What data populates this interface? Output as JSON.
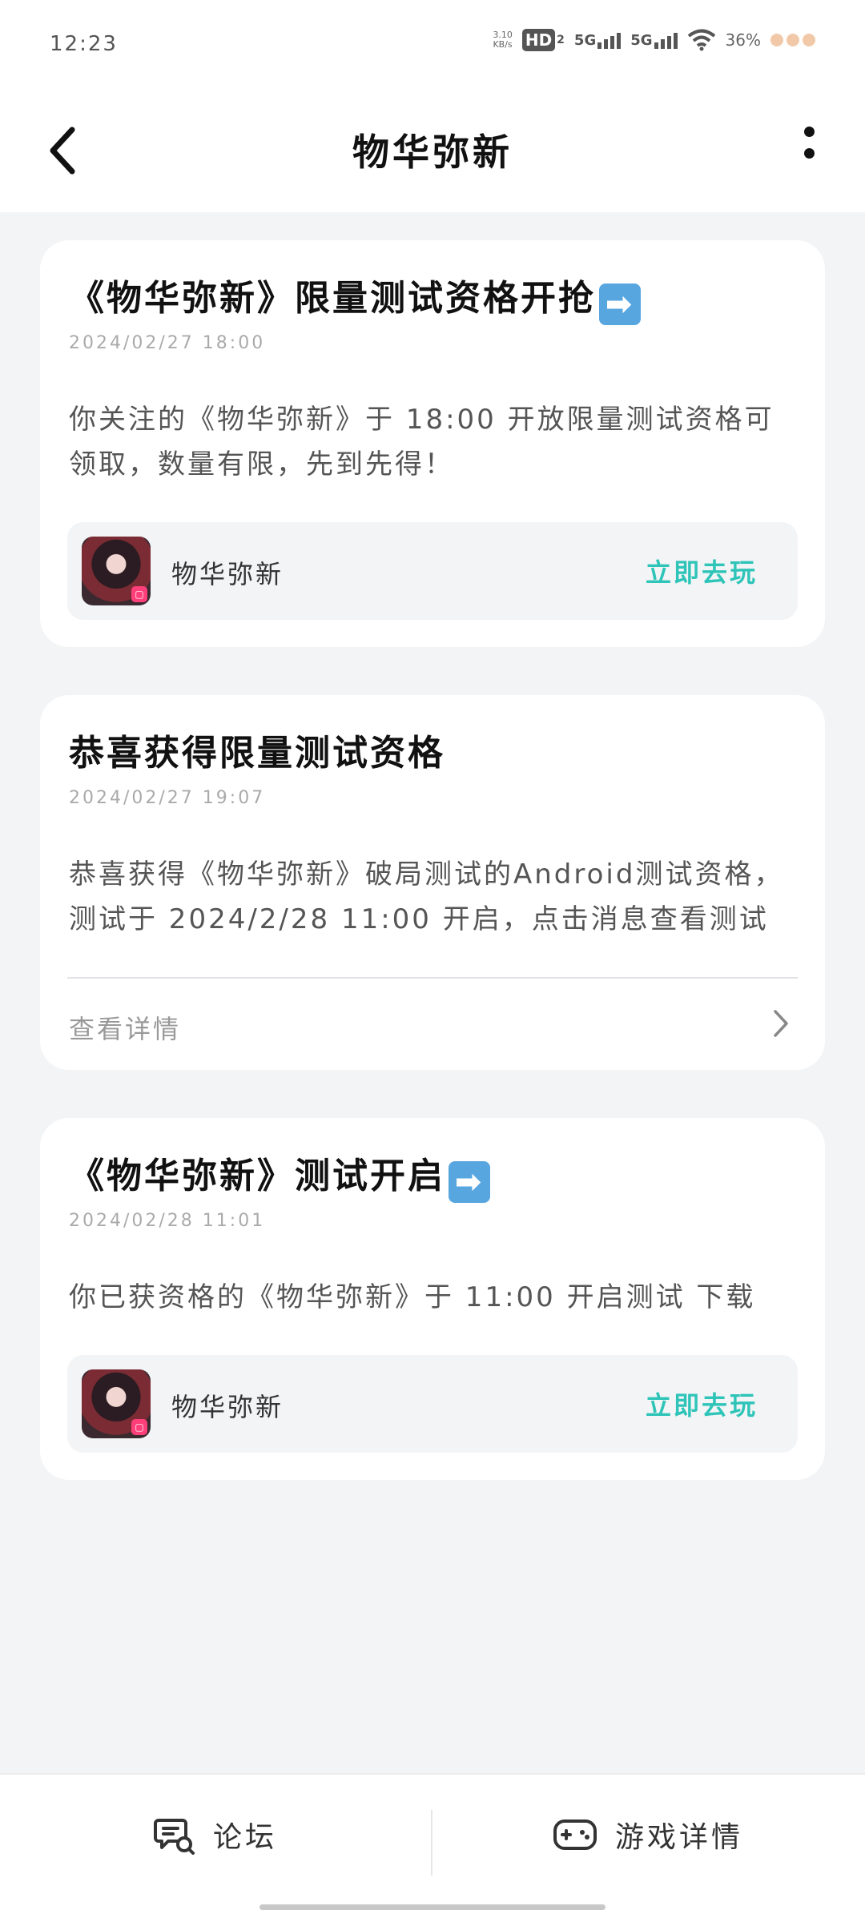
{
  "status_bar": {
    "time": "12:23",
    "net_speed_value": "3.10",
    "net_speed_unit": "KB/s",
    "hd_label": "HD",
    "hd_sub": "2",
    "signal1": "5G",
    "signal2": "5G",
    "battery": "36%"
  },
  "header": {
    "title": "物华弥新"
  },
  "messages": [
    {
      "title": "《物华弥新》限量测试资格开抢",
      "title_emoji": "➡",
      "time": "2024/02/27 18:00",
      "body": "你关注的《物华弥新》于 18:00 开放限量测试资格可领取，数量有限，先到先得！",
      "game_name": "物华弥新",
      "action": "立即去玩"
    },
    {
      "title": "恭喜获得限量测试资格",
      "time": "2024/02/27 19:07",
      "body": "恭喜获得《物华弥新》破局测试的Android测试资格，测试于 2024/2/28 11:00 开启，点击消息查看测试须知",
      "detail": "查看详情"
    },
    {
      "title": "《物华弥新》测试开启",
      "title_emoji": "➡",
      "time": "2024/02/28 11:01",
      "body": "你已获资格的《物华弥新》于 11:00 开启测试 下载",
      "game_name": "物华弥新",
      "action": "立即去玩"
    }
  ],
  "bottom_bar": {
    "forum": "论坛",
    "game_detail": "游戏详情"
  },
  "colors": {
    "accent": "#2ec4b8",
    "background": "#f3f4f6"
  }
}
